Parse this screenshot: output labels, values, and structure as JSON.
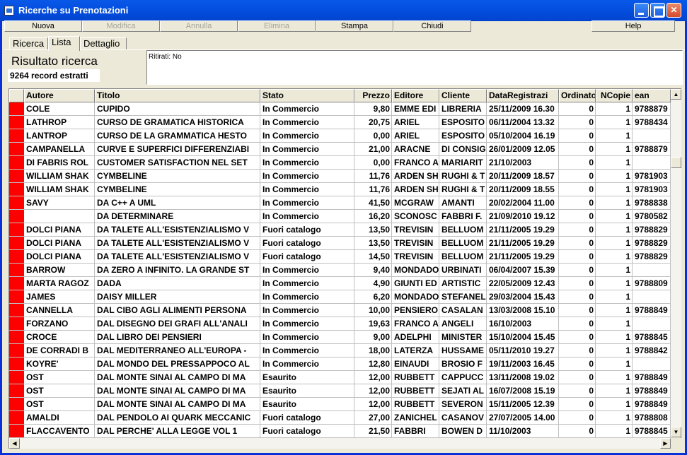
{
  "window": {
    "title": "Ricerche su Prenotazioni"
  },
  "toolbar": {
    "buttons": [
      {
        "label": "Nuova",
        "enabled": true
      },
      {
        "label": "Modifica",
        "enabled": false
      },
      {
        "label": "Annulla",
        "enabled": false
      },
      {
        "label": "Elimina",
        "enabled": false
      },
      {
        "label": "Stampa",
        "enabled": true
      },
      {
        "label": "Chiudi",
        "enabled": true
      },
      {
        "label": "Help",
        "enabled": true
      }
    ]
  },
  "tabs": [
    {
      "label": "Ricerca",
      "active": false
    },
    {
      "label": "Lista",
      "active": true
    },
    {
      "label": "Dettaglio",
      "active": false
    }
  ],
  "result": {
    "title": "Risultato ricerca",
    "count": "9264 record estratti",
    "filter": "Ritirati: No"
  },
  "grid": {
    "columns": [
      "Autore",
      "Titolo",
      "Stato",
      "Prezzo",
      "Editore",
      "Cliente",
      "DataRegistrazi",
      "Ordinato",
      "NCopie",
      "ean"
    ],
    "rows": [
      [
        "COLE",
        "CUPIDO",
        "In Commercio",
        "9,80",
        "EMME EDI",
        "LIBRERIA",
        "25/11/2009 16.30",
        "0",
        "1",
        "9788879"
      ],
      [
        "LATHROP",
        "CURSO DE GRAMATICA HISTORICA",
        "In Commercio",
        "20,75",
        "ARIEL",
        "ESPOSITO",
        "06/11/2004 13.32",
        "0",
        "1",
        "9788434"
      ],
      [
        "LANTROP",
        "CURSO DE LA GRAMMATICA HESTO",
        "In Commercio",
        "0,00",
        "ARIEL",
        "ESPOSITO",
        "05/10/2004 16.19",
        "0",
        "1",
        ""
      ],
      [
        "CAMPANELLA",
        "CURVE E SUPERFICI DIFFERENZIABI",
        "In Commercio",
        "21,00",
        "ARACNE",
        "DI CONSIG",
        "26/01/2009 12.05",
        "0",
        "1",
        "9788879"
      ],
      [
        "DI FABRIS ROL",
        "CUSTOMER SATISFACTION NEL SET",
        "In Commercio",
        "0,00",
        "FRANCO A",
        "MARIARIT",
        "21/10/2003",
        "0",
        "1",
        ""
      ],
      [
        "WILLIAM SHAK",
        "CYMBELINE",
        "In Commercio",
        "11,76",
        "ARDEN SH",
        "RUGHI & T",
        "20/11/2009 18.57",
        "0",
        "1",
        "9781903"
      ],
      [
        "WILLIAM SHAK",
        "CYMBELINE",
        "In Commercio",
        "11,76",
        "ARDEN SH",
        "RUGHI & T",
        "20/11/2009 18.55",
        "0",
        "1",
        "9781903"
      ],
      [
        "SAVY",
        "DA C++ A UML",
        "In Commercio",
        "41,50",
        "MCGRAW",
        "AMANTI",
        "20/02/2004 11.00",
        "0",
        "1",
        "9788838"
      ],
      [
        "",
        "DA DETERMINARE",
        "In Commercio",
        "16,20",
        "SCONOSC",
        "FABBRI F.",
        "21/09/2010 19.12",
        "0",
        "1",
        "9780582"
      ],
      [
        "DOLCI PIANA",
        "DA TALETE ALL'ESISTENZIALISMO V",
        "Fuori catalogo",
        "13,50",
        "TREVISIN",
        "BELLUOM",
        "21/11/2005 19.29",
        "0",
        "1",
        "9788829"
      ],
      [
        "DOLCI PIANA",
        "DA TALETE ALL'ESISTENZIALISMO V",
        "Fuori catalogo",
        "13,50",
        "TREVISIN",
        "BELLUOM",
        "21/11/2005 19.29",
        "0",
        "1",
        "9788829"
      ],
      [
        "DOLCI PIANA",
        "DA TALETE ALL'ESISTENZIALISMO V",
        "Fuori catalogo",
        "14,50",
        "TREVISIN",
        "BELLUOM",
        "21/11/2005 19.29",
        "0",
        "1",
        "9788829"
      ],
      [
        "BARROW",
        "DA ZERO A INFINITO. LA GRANDE ST",
        "In Commercio",
        "9,40",
        "MONDADO",
        "URBINATI",
        "06/04/2007 15.39",
        "0",
        "1",
        ""
      ],
      [
        "MARTA RAGOZ",
        "DADA",
        "In Commercio",
        "4,90",
        "GIUNTI ED",
        "ARTISTIC",
        "22/05/2009 12.43",
        "0",
        "1",
        "9788809"
      ],
      [
        "JAMES",
        "DAISY MILLER",
        "In Commercio",
        "6,20",
        "MONDADO",
        "STEFANEL",
        "29/03/2004 15.43",
        "0",
        "1",
        ""
      ],
      [
        "CANNELLA",
        "DAL CIBO AGLI ALIMENTI PERSONA",
        "In Commercio",
        "10,00",
        "PENSIERO",
        "CASALAN",
        "13/03/2008 15.10",
        "0",
        "1",
        "9788849"
      ],
      [
        "FORZANO",
        "DAL DISEGNO DEI GRAFI ALL'ANALI",
        "In Commercio",
        "19,63",
        "FRANCO A",
        "ANGELI",
        "16/10/2003",
        "0",
        "1",
        ""
      ],
      [
        "CROCE",
        "DAL LIBRO DEI PENSIERI",
        "In Commercio",
        "9,00",
        "ADELPHI",
        "MINISTER",
        "15/10/2004 15.45",
        "0",
        "1",
        "9788845"
      ],
      [
        "DE CORRADI B",
        "DAL MEDITERRANEO ALL'EUROPA -",
        "In Commercio",
        "18,00",
        "LATERZA",
        "HUSSAME",
        "05/11/2010 19.27",
        "0",
        "1",
        "9788842"
      ],
      [
        "KOYRE'",
        "DAL MONDO DEL PRESSAPPOCO AL",
        "In Commercio",
        "12,80",
        "EINAUDI",
        "BROSIO F",
        "19/11/2003 16.45",
        "0",
        "1",
        ""
      ],
      [
        "OST",
        "DAL MONTE SINAI AL CAMPO DI MA",
        "Esaurito",
        "12,00",
        "RUBBETT",
        "CAPPUCC",
        "13/11/2008 19.02",
        "0",
        "1",
        "9788849"
      ],
      [
        "OST",
        "DAL MONTE SINAI AL CAMPO DI MA",
        "Esaurito",
        "12,00",
        "RUBBETT",
        "SEJATI AL",
        "16/07/2008 15.19",
        "0",
        "1",
        "9788849"
      ],
      [
        "OST",
        "DAL MONTE SINAI AL CAMPO DI MA",
        "Esaurito",
        "12,00",
        "RUBBETT",
        "SEVERON",
        "15/11/2005 12.39",
        "0",
        "1",
        "9788849"
      ],
      [
        "AMALDI",
        "DAL PENDOLO AI QUARK MECCANIC",
        "Fuori catalogo",
        "27,00",
        "ZANICHEL",
        "CASANOV",
        "27/07/2005 14.00",
        "0",
        "1",
        "9788808"
      ],
      [
        "FLACCAVENTO",
        "DAL PERCHE' ALLA LEGGE VOL 1",
        "Fuori catalogo",
        "21,50",
        "FABBRI",
        "BOWEN D",
        "11/10/2003",
        "0",
        "1",
        "9788845"
      ]
    ]
  },
  "colors": {
    "indicator": "#ff0000",
    "titlebar": "#0450e0"
  }
}
